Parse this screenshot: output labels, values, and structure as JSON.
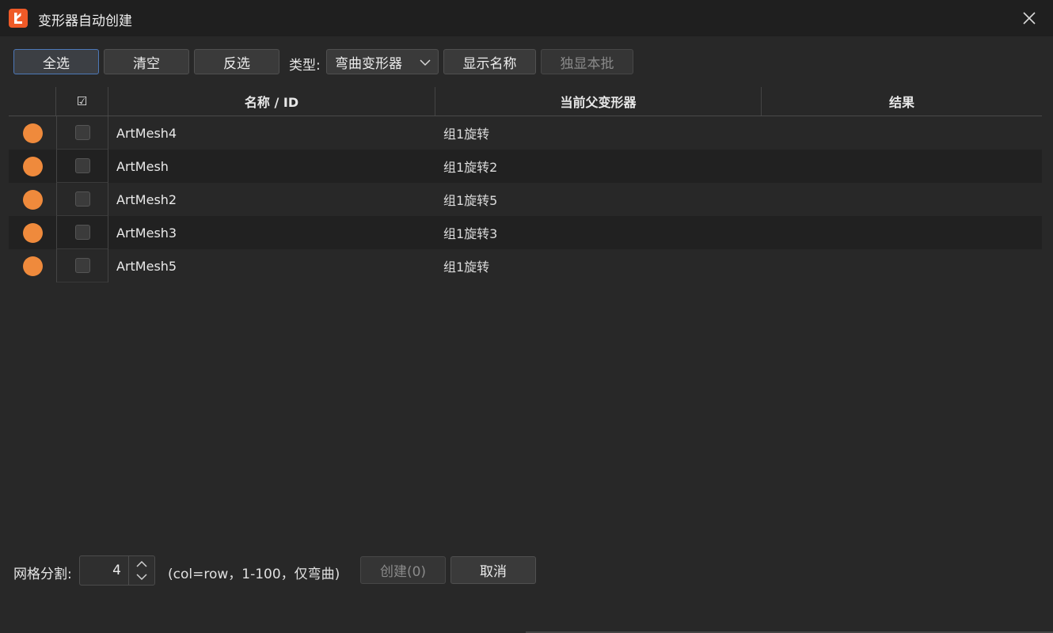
{
  "window": {
    "title": "变形器自动创建",
    "accent_color": "#ef5a28"
  },
  "toolbar": {
    "select_all": "全选",
    "clear": "清空",
    "invert": "反选",
    "type_label": "类型:",
    "type_value": "弯曲变形器",
    "show_name": "显示名称",
    "solo_batch": "独显本批"
  },
  "table": {
    "headers": {
      "check": "☑",
      "name": "名称 / ID",
      "parent": "当前父变形器",
      "result": "结果"
    },
    "rows": [
      {
        "name": "ArtMesh4",
        "parent": "组1旋转",
        "result": ""
      },
      {
        "name": "ArtMesh",
        "parent": "组1旋转2",
        "result": ""
      },
      {
        "name": "ArtMesh2",
        "parent": "组1旋转5",
        "result": ""
      },
      {
        "name": "ArtMesh3",
        "parent": "组1旋转3",
        "result": ""
      },
      {
        "name": "ArtMesh5",
        "parent": "组1旋转",
        "result": ""
      }
    ],
    "status_color": "#ef8a3c"
  },
  "footer": {
    "grid_label": "网格分割:",
    "grid_value": "4",
    "hint": "(col=row，1-100，仅弯曲)",
    "create": "创建(0)",
    "cancel": "取消"
  }
}
